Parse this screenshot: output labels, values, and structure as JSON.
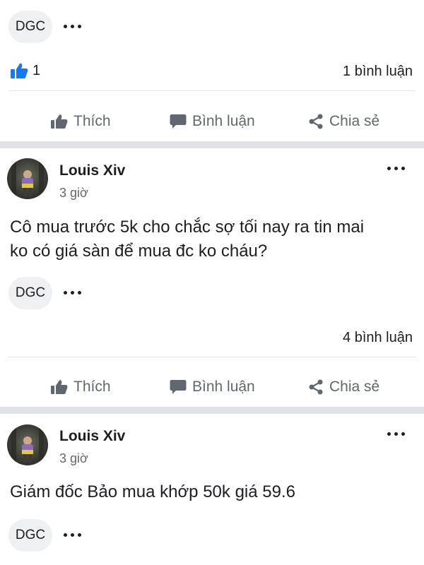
{
  "post0": {
    "tag": "DGC",
    "like_count": "1",
    "comments": "1 bình luận"
  },
  "actions": {
    "like": "Thích",
    "comment": "Bình luận",
    "share": "Chia sẻ"
  },
  "post1": {
    "author": "Louis Xiv",
    "time": "3 giờ",
    "content_line1": "Cô mua trước 5k cho chắc sợ tối nay ra tin mai",
    "content_line2": "ko có giá sàn để mua đc ko cháu?",
    "tag": "DGC",
    "comments": "4 bình luận"
  },
  "post2": {
    "author": "Louis Xiv",
    "time": "3 giờ",
    "content": "Giám đốc Bảo mua khớp 50k giá 59.6",
    "tag": "DGC"
  },
  "colors": {
    "like_blue": "#1877f2",
    "action_gray": "#606770",
    "tag_bg": "#eff0f2",
    "separator": "#e1e2e6"
  }
}
